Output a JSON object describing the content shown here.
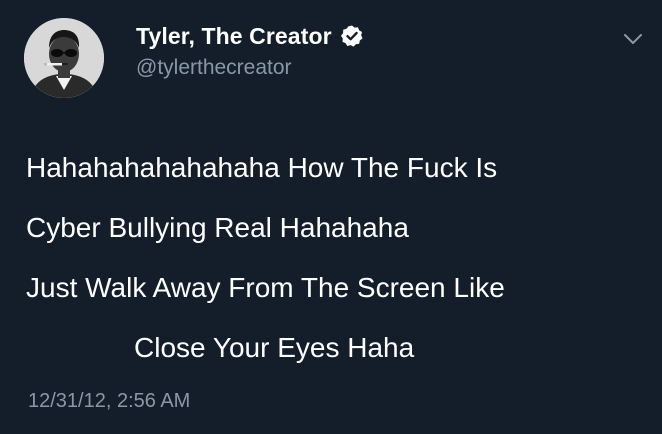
{
  "tweet": {
    "author": {
      "display_name": "Tyler, The Creator",
      "handle": "@tylerthecreator",
      "verified": true,
      "avatar_icon": "avatar-photo"
    },
    "text_lines": [
      "Hahahahahahahaha How The Fuck Is",
      "Cyber Bullying Real Hahahaha",
      "Just Walk Away From The Screen Like",
      "Close Your Eyes Haha"
    ],
    "timestamp": "12/31/12, 2:56 AM",
    "menu_icon": "chevron-down-icon"
  },
  "colors": {
    "background": "#141d2a",
    "primary_text": "#ffffff",
    "secondary_text": "#8899a6",
    "verified_badge": "#ffffff"
  }
}
